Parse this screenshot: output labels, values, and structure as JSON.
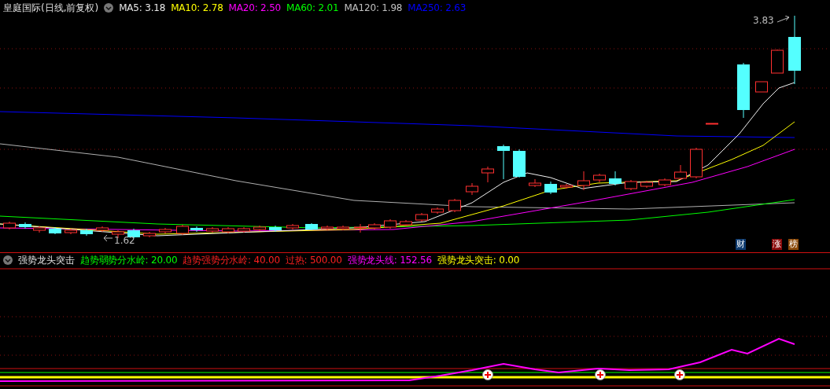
{
  "header": {
    "title": "皇庭国际(日线,前复权)",
    "indicators": [
      {
        "label": "MA5: 3.18",
        "color": "#e8e8e8"
      },
      {
        "label": "MA10: 2.78",
        "color": "#ffff00"
      },
      {
        "label": "MA20: 2.50",
        "color": "#ff00ff"
      },
      {
        "label": "MA60: 2.01",
        "color": "#00ff00"
      },
      {
        "label": "MA120: 1.98",
        "color": "#c0c0c0"
      },
      {
        "label": "MA250: 2.63",
        "color": "#0000ff"
      }
    ]
  },
  "main_chart": {
    "high_label": "3.83",
    "low_label": "1.62",
    "badges": [
      {
        "text": "财",
        "color": "#0e3a6e"
      },
      {
        "text": "涨",
        "color": "#8a0a0a"
      },
      {
        "text": "榜",
        "color": "#8a4a0a"
      }
    ]
  },
  "indicator_panel": {
    "title": "强势龙头突击",
    "values": [
      {
        "label": "趋势弱势分水岭: 20.00",
        "color": "#00ff00"
      },
      {
        "label": "趋势强势分水岭: 40.00",
        "color": "#ff2020"
      },
      {
        "label": "过热: 500.00",
        "color": "#ff2020"
      },
      {
        "label": "强势龙头线: 152.56",
        "color": "#ff00ff"
      },
      {
        "label": "强势龙头突击: 0.00",
        "color": "#ffff00"
      }
    ]
  }
}
